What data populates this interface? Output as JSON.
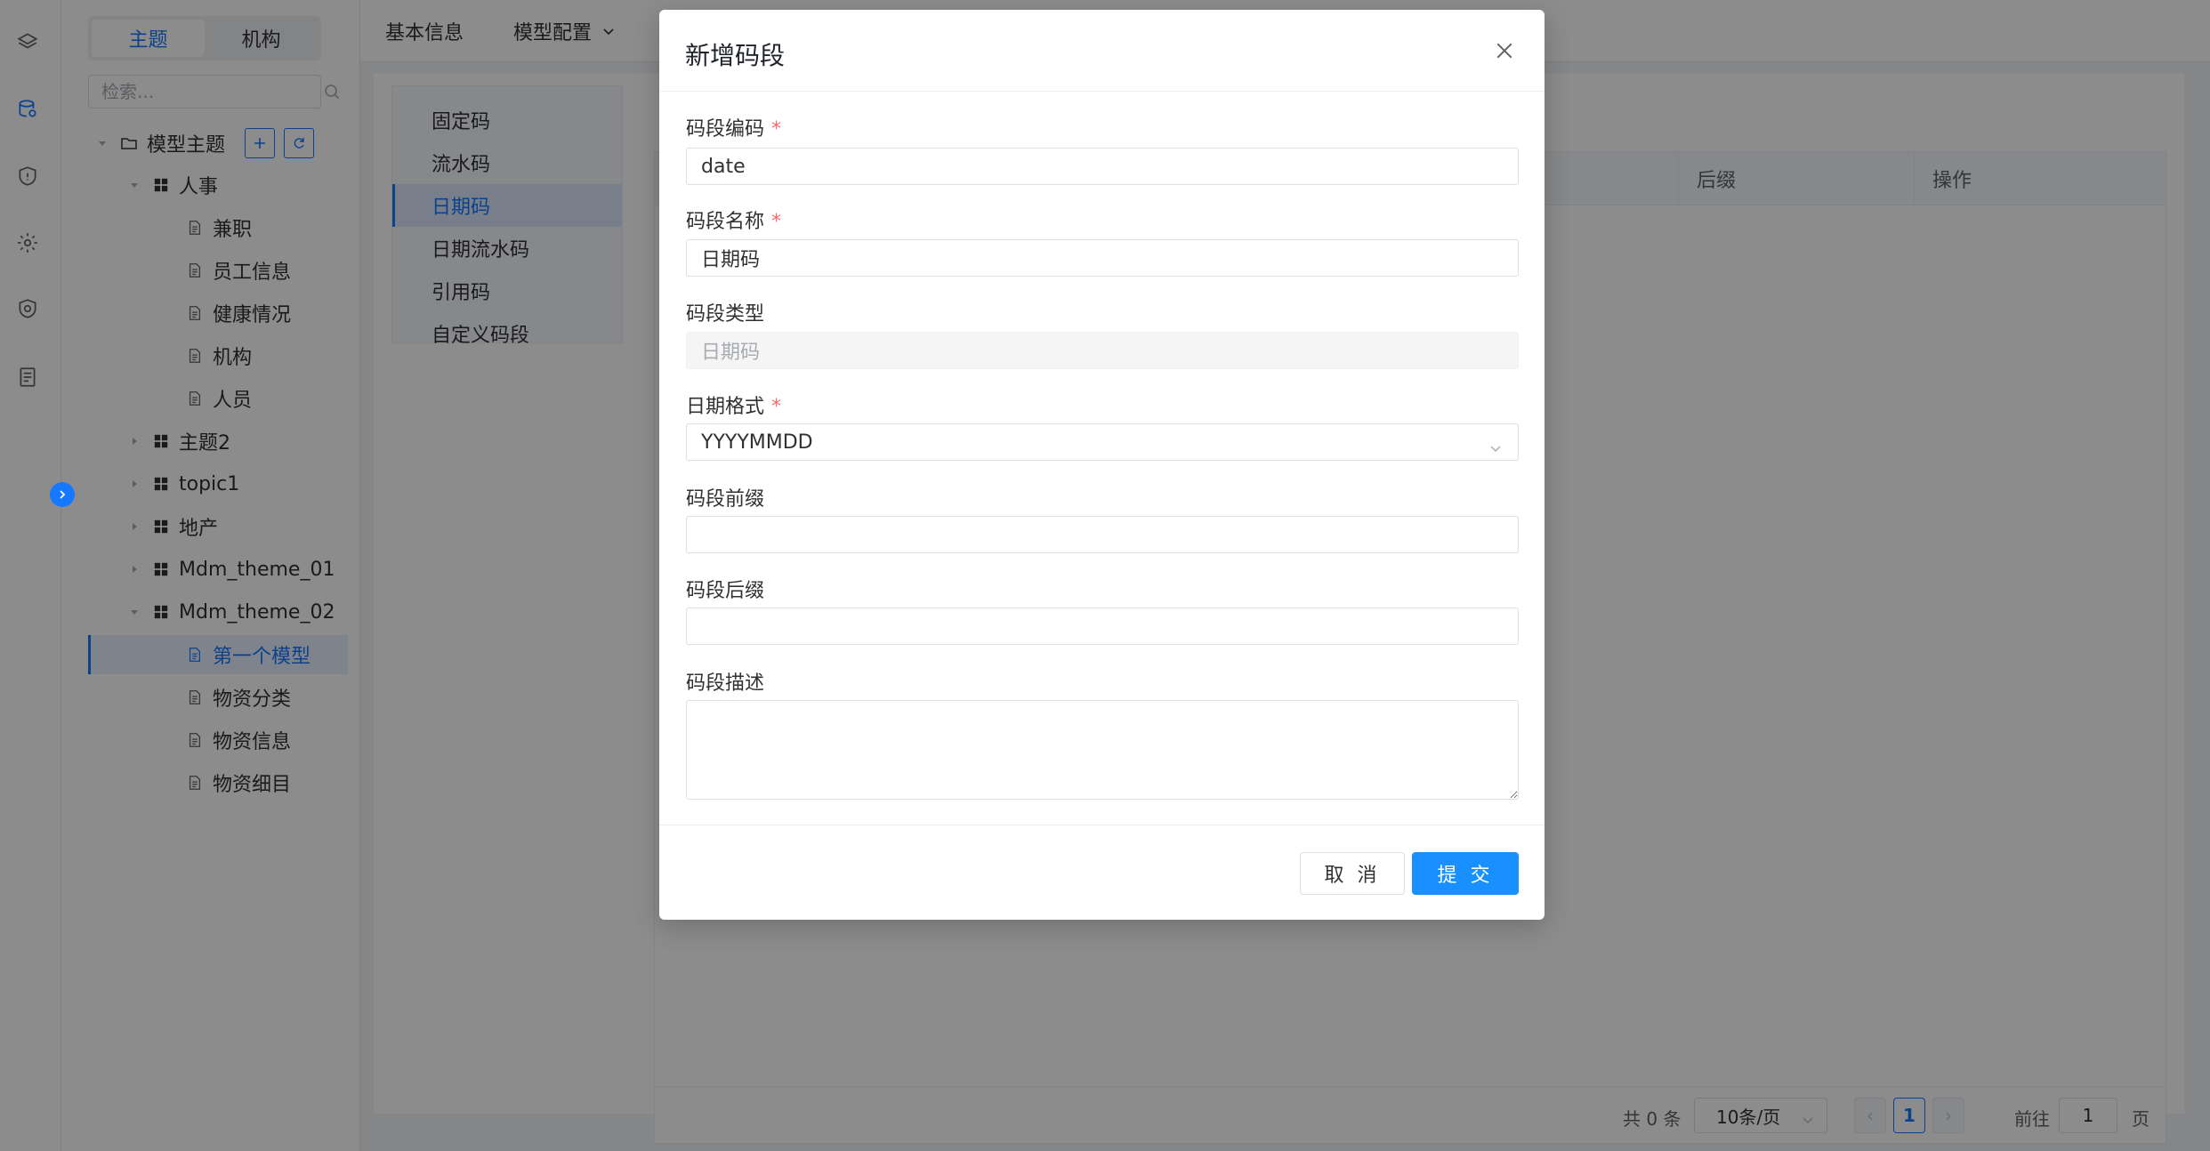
{
  "rail": {
    "icons": [
      "layers-icon",
      "database-icon",
      "shield-icon",
      "gear-icon",
      "security-icon",
      "document-icon"
    ]
  },
  "tree": {
    "segment": {
      "topic": "主题",
      "org": "机构"
    },
    "search_placeholder": "检索...",
    "root_label": "模型主题",
    "nodes": [
      {
        "label": "人事"
      },
      {
        "label": "兼职"
      },
      {
        "label": "员工信息"
      },
      {
        "label": "健康情况"
      },
      {
        "label": "机构"
      },
      {
        "label": "人员"
      },
      {
        "label": "主题2"
      },
      {
        "label": "topic1"
      },
      {
        "label": "地产"
      },
      {
        "label": "Mdm_theme_01"
      },
      {
        "label": "Mdm_theme_02"
      },
      {
        "label": "第一个模型"
      },
      {
        "label": "物资分类"
      },
      {
        "label": "物资信息"
      },
      {
        "label": "物资细目"
      }
    ]
  },
  "topbar": {
    "tab_basic": "基本信息",
    "tab_config": "模型配置"
  },
  "code_types": [
    "固定码",
    "流水码",
    "日期码",
    "日期流水码",
    "引用码",
    "自定义码段"
  ],
  "grid": {
    "col_suffix": "后缀",
    "col_action": "操作"
  },
  "pager": {
    "total": "共 0 条",
    "page_size": "10条/页",
    "prev": "‹",
    "page": "1",
    "next": "›",
    "goto": "前往",
    "goto_value": "1",
    "page_unit": "页"
  },
  "modal": {
    "title": "新增码段",
    "code_label": "码段编码",
    "code_value": "date",
    "name_label": "码段名称",
    "name_value": "日期码",
    "type_label": "码段类型",
    "type_value": "日期码",
    "format_label": "日期格式",
    "format_value": "YYYYMMDD",
    "prefix_label": "码段前缀",
    "suffix_label": "码段后缀",
    "desc_label": "码段描述",
    "required_mark": "*",
    "cancel": "取 消",
    "submit": "提 交"
  },
  "colors": {
    "accent": "#1677ff",
    "submit": "#1890ff",
    "required": "#f56c6c"
  }
}
